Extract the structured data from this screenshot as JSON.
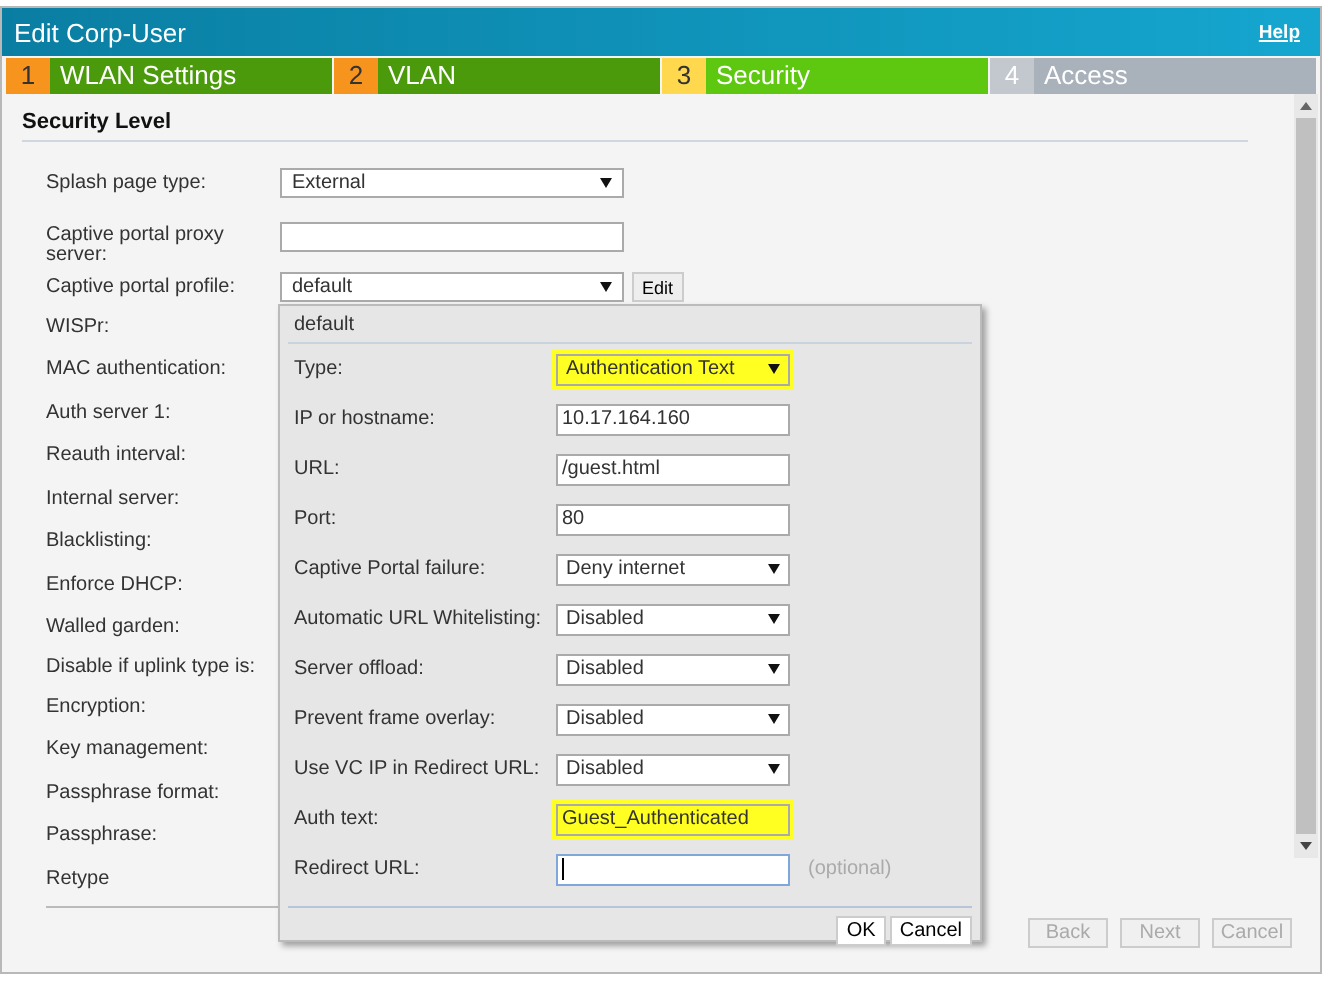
{
  "window": {
    "title": "Edit Corp-User",
    "help": "Help"
  },
  "steps": [
    {
      "number": "1",
      "label": "WLAN Settings",
      "selected": false,
      "completed": true
    },
    {
      "number": "2",
      "label": "VLAN",
      "selected": false,
      "completed": true
    },
    {
      "number": "3",
      "label": "Security",
      "selected": true,
      "completed": false
    },
    {
      "number": "4",
      "label": "Access",
      "selected": false,
      "completed": false
    }
  ],
  "section": {
    "title": "Security Level"
  },
  "form": {
    "rows": [
      {
        "label": "Splash page type:",
        "kind": "select",
        "value": "External"
      },
      {
        "label": "Captive portal proxy server:",
        "kind": "input"
      },
      {
        "label": "Captive portal profile:",
        "kind": "select",
        "value": "default",
        "button": "Edit"
      },
      {
        "label": "WISPr:",
        "kind": "label"
      },
      {
        "label": "MAC authentication:",
        "kind": "label"
      },
      {
        "label": "Auth server 1:",
        "kind": "label"
      },
      {
        "label": "Reauth interval:",
        "kind": "label"
      },
      {
        "label": "Internal server:",
        "kind": "label"
      },
      {
        "label": "Blacklisting:",
        "kind": "label"
      },
      {
        "label": "Enforce DHCP:",
        "kind": "label"
      },
      {
        "label": "Walled garden:",
        "kind": "label"
      },
      {
        "label": "Disable if uplink type is:",
        "kind": "label"
      },
      {
        "label": "Encryption:",
        "kind": "label"
      },
      {
        "label": "Key management:",
        "kind": "label"
      },
      {
        "label": "Passphrase format:",
        "kind": "label"
      },
      {
        "label": "Passphrase:",
        "kind": "label"
      },
      {
        "label": "Retype",
        "kind": "label"
      }
    ]
  },
  "popup": {
    "title": "default",
    "rows": [
      {
        "label": "Type:",
        "kind": "select",
        "value": "Authentication Text",
        "highlighted": true
      },
      {
        "label": "IP or hostname:",
        "kind": "input",
        "value": "10.17.164.160",
        "highlighted": false
      },
      {
        "label": "URL:",
        "kind": "input",
        "value": "/guest.html",
        "highlighted": false
      },
      {
        "label": "Port:",
        "kind": "input",
        "value": "80",
        "highlighted": false
      },
      {
        "label": "Captive Portal failure:",
        "kind": "select",
        "value": "Deny internet",
        "highlighted": false
      },
      {
        "label": "Automatic URL Whitelisting:",
        "kind": "select",
        "value": "Disabled",
        "highlighted": false
      },
      {
        "label": "Server offload:",
        "kind": "select",
        "value": "Disabled",
        "highlighted": false
      },
      {
        "label": "Prevent frame overlay:",
        "kind": "select",
        "value": "Disabled",
        "highlighted": false
      },
      {
        "label": "Use VC IP in Redirect URL:",
        "kind": "select",
        "value": "Disabled",
        "highlighted": false
      },
      {
        "label": "Auth text:",
        "kind": "input",
        "value": "Guest_Authenticated",
        "highlighted": true
      },
      {
        "label": "Redirect URL:",
        "kind": "input",
        "focused": true,
        "hint": "(optional)",
        "highlighted": false
      }
    ],
    "buttons": [
      "OK",
      "Cancel"
    ]
  },
  "footer_buttons": [
    {
      "label": "Back",
      "disabled": true
    },
    {
      "label": "Next",
      "disabled": true
    },
    {
      "label": "Cancel",
      "disabled": true
    }
  ]
}
